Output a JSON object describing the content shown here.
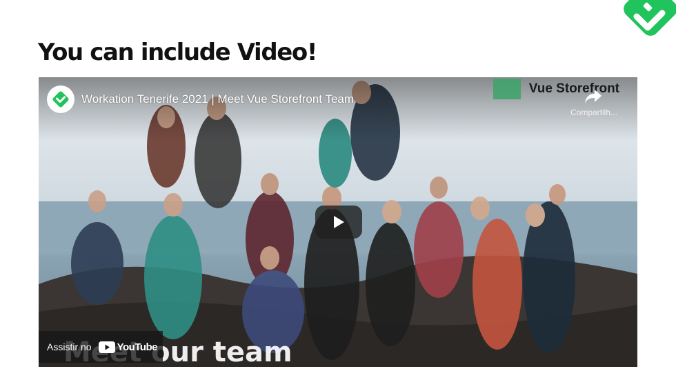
{
  "slide": {
    "title": "You can include Video!",
    "logo_icon": "storefront-check-icon",
    "accent_color": "#21c45c"
  },
  "video": {
    "title": "Workation Tenerife 2021 | Meet Vue Storefront Team",
    "channel_avatar_icon": "storefront-check-icon",
    "brand_name": "Vue Storefront",
    "share_label": "Compartilh...",
    "play_icon": "play-icon",
    "watch_on_label": "Assistir no",
    "youtube_word": "YouTube",
    "overlay_caption": "Meet our team"
  }
}
